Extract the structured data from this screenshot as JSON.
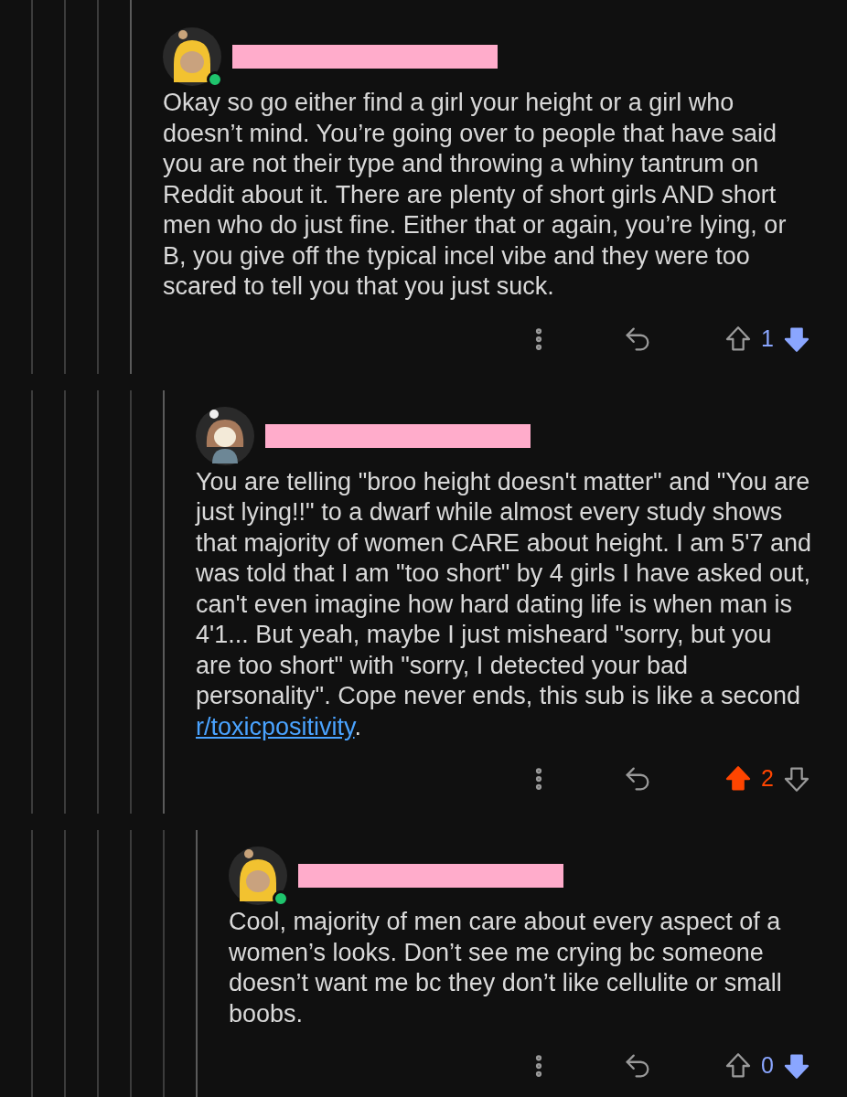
{
  "comments": [
    {
      "avatar": {
        "kind": "hooded",
        "online": true
      },
      "username_redacted": true,
      "body": [
        {
          "kind": "text",
          "text": "Okay so go either find a girl your height or a girl who doesn’t mind. You’re going over to people that have said you are not their type and throwing a whiny tantrum on Reddit about it. There are plenty of short girls AND short men who do just fine. Either that or again, you’re lying, or B, you give off the typical incel vibe and they were too scared to tell you that you just suck."
        }
      ],
      "upvoted": false,
      "downvoted": true,
      "score": "1",
      "children": [
        {
          "avatar": {
            "kind": "hair",
            "online": false
          },
          "username_redacted": true,
          "body": [
            {
              "kind": "text",
              "text": "You are telling \"broo height doesn't matter\" and \"You are just lying!!\" to a dwarf while almost every study shows that majority of women CARE about height. I am 5'7 and was told that I am \"too short\" by 4 girls I have asked out, can't even imagine how hard dating life is when man is 4'1... But yeah, maybe I just misheard \"sorry, but you are too short\" with \"sorry, I detected your bad personality\". Cope never ends, this sub is like a second "
            },
            {
              "kind": "link",
              "text": "r/toxicpositivity"
            },
            {
              "kind": "text",
              "text": "."
            }
          ],
          "upvoted": true,
          "downvoted": false,
          "score": "2",
          "children": [
            {
              "avatar": {
                "kind": "hooded",
                "online": true
              },
              "username_redacted": true,
              "body": [
                {
                  "kind": "text",
                  "text": "Cool, majority of men care about every aspect of a women’s looks. Don’t see me crying bc someone doesn’t want me bc they don’t like cellulite or small boobs."
                }
              ],
              "upvoted": false,
              "downvoted": true,
              "score": "0"
            }
          ]
        }
      ]
    }
  ]
}
